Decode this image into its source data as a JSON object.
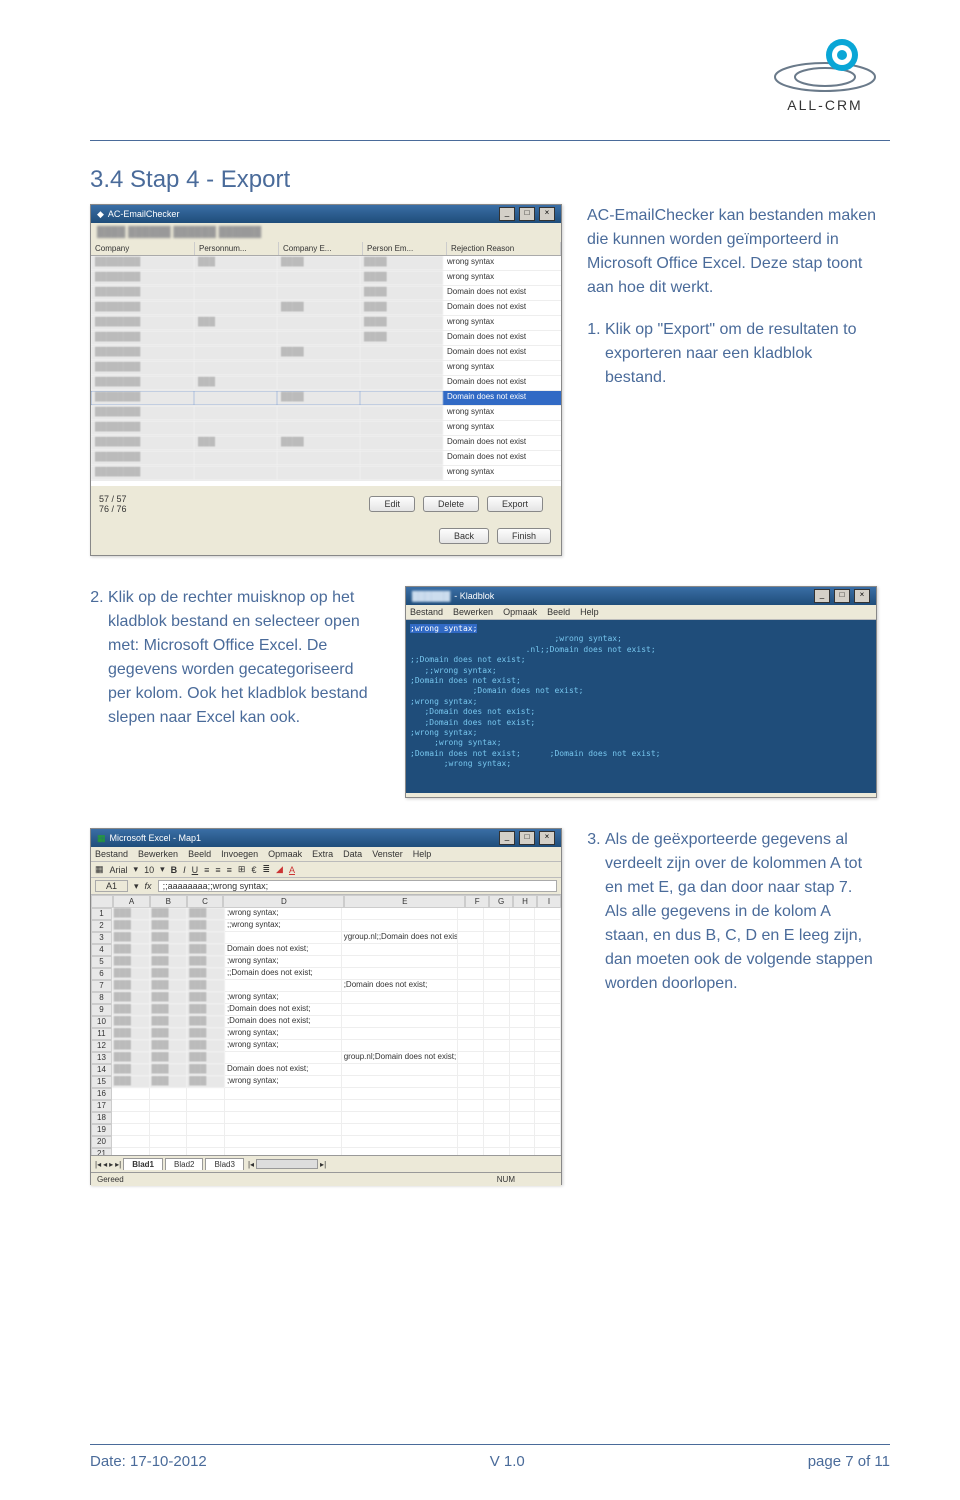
{
  "logo_text": "ALL-CRM",
  "section_title": "3.4 Stap 4 - Export",
  "intro": "AC-EmailChecker kan bestanden maken die kunnen worden geïmporteerd in Microsoft Office Excel. Deze stap toont aan hoe dit werkt.",
  "step1": "Klik op \"Export\" om de resultaten to exporteren naar een kladblok bestand.",
  "step2": "Klik op de rechter muisknop op het kladblok bestand en selecteer open met: Microsoft Office Excel. De gegevens worden gecategoriseerd per kolom. Ook het kladblok bestand slepen naar Excel kan ook.",
  "step3a": "Als de geëxporteerde gegevens al verdeelt zijn over de kolommen A tot en met E, ga dan door naar stap 7.",
  "step3b": "Als alle gegevens in de kolom A staan, en dus B, C, D en E leeg zijn, dan moeten ook de volgende stappen worden doorlopen.",
  "ss1": {
    "title": "AC-EmailChecker",
    "cols": [
      "Company",
      "Personnum...",
      "Company E...",
      "Person Em...",
      "Rejection Reason"
    ],
    "reasons": [
      "wrong syntax",
      "wrong syntax",
      "Domain does not exist",
      "Domain does not exist",
      "wrong syntax",
      "Domain does not exist",
      "Domain does not exist",
      "wrong syntax",
      "Domain does not exist",
      "Domain does not exist",
      "wrong syntax",
      "wrong syntax",
      "Domain does not exist",
      "Domain does not exist",
      "wrong syntax"
    ],
    "selected_index": 9,
    "status1": "57 / 57",
    "status2": "76 / 76",
    "buttons_row1": [
      "Edit",
      "Delete",
      "Export"
    ],
    "buttons_row2": [
      "Back",
      "Finish"
    ]
  },
  "ss2": {
    "title_suffix": " - Kladblok",
    "menus": [
      "Bestand",
      "Bewerken",
      "Opmaak",
      "Beeld",
      "Help"
    ],
    "lines": [
      ";wrong syntax;",
      "                              ;wrong syntax;",
      "                        .nl;;Domain does not exist;",
      ";;Domain does not exist;",
      "   ;;wrong syntax;",
      ";Domain does not exist;",
      "             ;Domain does not exist;",
      ";wrong syntax;",
      "   ;Domain does not exist;",
      "   ;Domain does not exist;",
      ";wrong syntax;",
      "     ;wrong syntax;",
      ";Domain does not exist;      ;Domain does not exist;",
      "       ;wrong syntax;"
    ]
  },
  "ss3": {
    "title": "Microsoft Excel - Map1",
    "menus": [
      "Bestand",
      "Bewerken",
      "Beeld",
      "Invoegen",
      "Opmaak",
      "Extra",
      "Data",
      "Venster",
      "Help"
    ],
    "font": "Arial",
    "fontsize": "10",
    "cellref": "A1",
    "formula": ";;aaaaaaaa;;wrong syntax;",
    "cols": [
      "A",
      "B",
      "C",
      "D",
      "E",
      "F",
      "G",
      "H",
      "I"
    ],
    "rows": [
      [
        "",
        "",
        "",
        ";wrong syntax;",
        "",
        "",
        "",
        "",
        ""
      ],
      [
        "",
        "",
        "",
        ";;wrong syntax;",
        "",
        "",
        "",
        "",
        ""
      ],
      [
        "",
        "",
        "",
        "",
        "ygroup.nl;;Domain does not exist;",
        "",
        "",
        "",
        ""
      ],
      [
        "",
        "",
        "",
        "Domain does not exist;",
        "",
        "",
        "",
        "",
        ""
      ],
      [
        "",
        "",
        "",
        ";wrong syntax;",
        "",
        "",
        "",
        "",
        ""
      ],
      [
        "",
        "",
        "",
        ";;Domain does not exist;",
        "",
        "",
        "",
        "",
        ""
      ],
      [
        "",
        "",
        "",
        "",
        ";Domain does not exist;",
        "",
        "",
        "",
        ""
      ],
      [
        "",
        "",
        "",
        ";wrong syntax;",
        "",
        "",
        "",
        "",
        ""
      ],
      [
        "",
        "",
        "",
        ";Domain does not exist;",
        "",
        "",
        "",
        "",
        ""
      ],
      [
        "",
        "",
        "",
        ";Domain does not exist;",
        "",
        "",
        "",
        "",
        ""
      ],
      [
        "",
        "",
        "",
        ";wrong syntax;",
        "",
        "",
        "",
        "",
        ""
      ],
      [
        "",
        "",
        "",
        ";wrong syntax;",
        "",
        "",
        "",
        "",
        ""
      ],
      [
        "",
        "",
        "",
        "",
        "group.nl;Domain does not exist;",
        "",
        "",
        "",
        ""
      ],
      [
        "",
        "",
        "",
        "Domain does not exist;",
        "",
        "",
        "",
        "",
        ""
      ],
      [
        "",
        "",
        "",
        ";wrong syntax;",
        "",
        "",
        "",
        "",
        ""
      ],
      [
        "",
        "",
        "",
        "",
        "",
        "",
        "",
        "",
        ""
      ],
      [
        "",
        "",
        "",
        "",
        "",
        "",
        "",
        "",
        ""
      ],
      [
        "",
        "",
        "",
        "",
        "",
        "",
        "",
        "",
        ""
      ],
      [
        "",
        "",
        "",
        "",
        "",
        "",
        "",
        "",
        ""
      ],
      [
        "",
        "",
        "",
        "",
        "",
        "",
        "",
        "",
        ""
      ],
      [
        "",
        "",
        "",
        "",
        "",
        "",
        "",
        "",
        ""
      ],
      [
        "",
        "",
        "",
        "",
        "",
        "",
        "",
        "",
        ""
      ],
      [
        "",
        "",
        "",
        "",
        "",
        "",
        "",
        "",
        ""
      ]
    ],
    "tabs": [
      "Blad1",
      "Blad2",
      "Blad3"
    ],
    "status_left": "Gereed",
    "status_mid": "NUM"
  },
  "footer": {
    "left": "Date: 17-10-2012",
    "mid": "V 1.0",
    "right": "page 7 of 11"
  }
}
